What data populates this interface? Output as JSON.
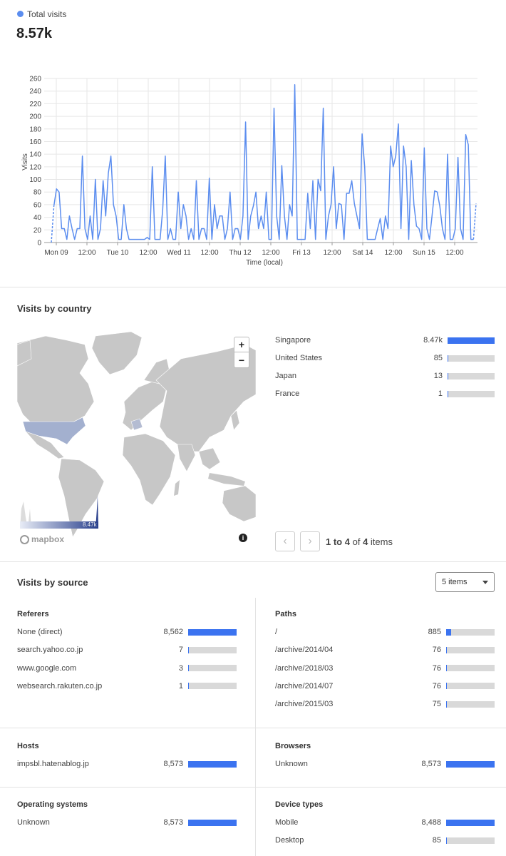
{
  "summary": {
    "legend_label": "Total visits",
    "total": "8.57k"
  },
  "chart_data": {
    "type": "line",
    "xlabel": "Time (local)",
    "ylabel": "Visits",
    "ylim": [
      0,
      260
    ],
    "yticks": [
      "0",
      "20",
      "40",
      "60",
      "80",
      "100",
      "120",
      "140",
      "160",
      "180",
      "200",
      "220",
      "240",
      "260"
    ],
    "xticks": [
      "Mon 09",
      "12:00",
      "Tue 10",
      "12:00",
      "Wed 11",
      "12:00",
      "Thu 12",
      "12:00",
      "Fri 13",
      "12:00",
      "Sat 14",
      "12:00",
      "Sun 15",
      "12:00"
    ],
    "color": "#5b8def",
    "series": [
      {
        "values": [
          0,
          58,
          85,
          80,
          22,
          22,
          5,
          42,
          22,
          5,
          22,
          22,
          137,
          22,
          5,
          42,
          5,
          100,
          5,
          22,
          98,
          42,
          110,
          137,
          60,
          42,
          5,
          5,
          60,
          22,
          5,
          5,
          5,
          5,
          5,
          5,
          5,
          8,
          5,
          120,
          5,
          5,
          5,
          52,
          137,
          5,
          22,
          5,
          5,
          80,
          22,
          60,
          42,
          5,
          22,
          5,
          98,
          5,
          22,
          22,
          5,
          102,
          5,
          60,
          22,
          42,
          42,
          5,
          22,
          80,
          5,
          22,
          22,
          5,
          42,
          191,
          5,
          42,
          58,
          80,
          22,
          42,
          22,
          80,
          5,
          5,
          213,
          42,
          5,
          122,
          42,
          5,
          60,
          42,
          250,
          5,
          5,
          5,
          5,
          78,
          22,
          98,
          5,
          100,
          82,
          213,
          5,
          42,
          60,
          120,
          22,
          62,
          60,
          5,
          78,
          78,
          98,
          62,
          42,
          22,
          172,
          120,
          5,
          5,
          5,
          5,
          22,
          38,
          5,
          42,
          22,
          153,
          120,
          137,
          188,
          22,
          153,
          120,
          5,
          130,
          60,
          26,
          22,
          5,
          150,
          22,
          5,
          42,
          82,
          80,
          58,
          22,
          5,
          140,
          5,
          5,
          22,
          135,
          22,
          5,
          171,
          155,
          5,
          5,
          62
        ]
      }
    ]
  },
  "country": {
    "title": "Visits by country",
    "rows": [
      {
        "label": "Singapore",
        "value": "8.47k",
        "frac": 1.0
      },
      {
        "label": "United States",
        "value": "85",
        "frac": 0.012
      },
      {
        "label": "Japan",
        "value": "13",
        "frac": 0.006
      },
      {
        "label": "France",
        "value": "1",
        "frac": 0.003
      }
    ],
    "pagination": {
      "range": "1 to 4",
      "of": "of",
      "total": "4",
      "items": "items"
    },
    "map": {
      "legend_max": "8.47k",
      "logo": "mapbox",
      "zoom_in": "+",
      "zoom_out": "−",
      "info": "i"
    }
  },
  "source": {
    "title": "Visits by source",
    "select_value": "5 items",
    "referers": {
      "title": "Referers",
      "rows": [
        {
          "label": "None (direct)",
          "value": "8,562",
          "frac": 1.0
        },
        {
          "label": "search.yahoo.co.jp",
          "value": "7",
          "frac": 0.0
        },
        {
          "label": "www.google.com",
          "value": "3",
          "frac": 0.0
        },
        {
          "label": "websearch.rakuten.co.jp",
          "value": "1",
          "frac": 0.0
        }
      ]
    },
    "paths": {
      "title": "Paths",
      "rows": [
        {
          "label": "/",
          "value": "885",
          "frac": 0.1
        },
        {
          "label": "/archive/2014/04",
          "value": "76",
          "frac": 0.012
        },
        {
          "label": "/archive/2018/03",
          "value": "76",
          "frac": 0.012
        },
        {
          "label": "/archive/2014/07",
          "value": "76",
          "frac": 0.012
        },
        {
          "label": "/archive/2015/03",
          "value": "75",
          "frac": 0.012
        }
      ]
    },
    "hosts": {
      "title": "Hosts",
      "rows": [
        {
          "label": "impsbl.hatenablog.jp",
          "value": "8,573",
          "frac": 1.0
        }
      ]
    },
    "browsers": {
      "title": "Browsers",
      "rows": [
        {
          "label": "Unknown",
          "value": "8,573",
          "frac": 1.0
        }
      ]
    },
    "os": {
      "title": "Operating systems",
      "rows": [
        {
          "label": "Unknown",
          "value": "8,573",
          "frac": 1.0
        }
      ]
    },
    "devices": {
      "title": "Device types",
      "rows": [
        {
          "label": "Mobile",
          "value": "8,488",
          "frac": 1.0
        },
        {
          "label": "Desktop",
          "value": "85",
          "frac": 0.012
        }
      ]
    }
  }
}
